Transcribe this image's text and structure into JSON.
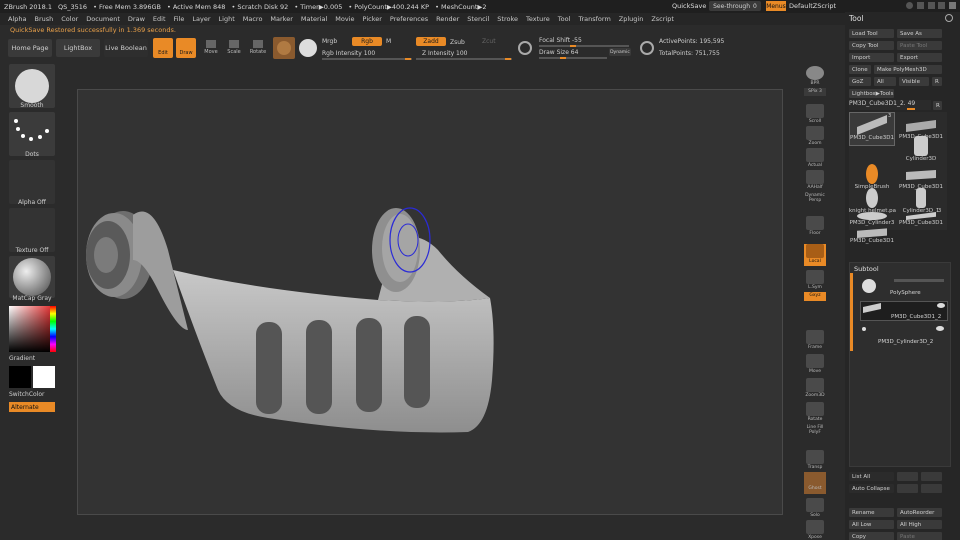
{
  "titlebar": {
    "items": [
      "ZBrush 2018.1",
      "QS_3516",
      "• Free Mem 3.896GB",
      "• Active Mem 848",
      "• Scratch Disk 92",
      "• Timer▶0.005",
      "• PolyCount▶400.244 KP",
      "• MeshCount▶2"
    ],
    "quicksave": "QuickSave",
    "seethrough": "See-through",
    "seethrough_value": "0",
    "menus": "Menus",
    "script": "DefaultZScript"
  },
  "menubar": [
    "Alpha",
    "Brush",
    "Color",
    "Document",
    "Draw",
    "Edit",
    "File",
    "Layer",
    "Light",
    "Macro",
    "Marker",
    "Material",
    "Movie",
    "Picker",
    "Preferences",
    "Render",
    "Stencil",
    "Stroke",
    "Texture",
    "Tool",
    "Transform",
    "Zplugin",
    "Zscript"
  ],
  "status": "QuickSave Restored successfully in 1.369 seconds.",
  "topshelf": {
    "home": "Home Page",
    "lightbox": "LightBox",
    "liveboolean": "Live Boolean",
    "edit": "Edit",
    "draw": "Draw",
    "move": "Move",
    "scale": "Scale",
    "rotate": "Rotate",
    "mrgb": "Mrgb",
    "rgb": "Rgb",
    "m": "M",
    "zadd": "Zadd",
    "zsub": "Zsub",
    "zcut": "Zcut",
    "rgb_intensity": "Rgb Intensity 100",
    "z_intensity": "Z Intensity 100",
    "focal_shift": "Focal Shift -55",
    "draw_size": "Draw Size 64",
    "dynamic": "Dynamic",
    "active_points": "ActivePoints: 195,595",
    "total_points": "TotalPoints: 751,755"
  },
  "leftcol": {
    "brush": "Smooth",
    "stroke": "Dots",
    "alpha": "Alpha Off",
    "texture": "Texture Off",
    "material": "MatCap Gray",
    "gradient": "Gradient",
    "switchcolor": "SwitchColor",
    "alternate": "Alternate"
  },
  "rightshelf": {
    "items": [
      "BPR",
      "SPix 3",
      "Scroll",
      "Zoom",
      "Actual",
      "AAHalf",
      "Dynamic Persp",
      "Floor",
      "Local",
      "L.Sym",
      "Gxyz",
      "Frame",
      "Move",
      "Zoom3D",
      "Rotate",
      "Line Fill PolyF",
      "Transp",
      "Ghost",
      "Solo",
      "Xpose"
    ]
  },
  "tool": {
    "title": "Tool",
    "load": "Load Tool",
    "saveas": "Save As",
    "copy": "Copy Tool",
    "paste": "Paste Tool",
    "import": "Import",
    "export": "Export",
    "clone": "Clone",
    "make_polymesh": "Make PolyMesh3D",
    "goz": "GoZ",
    "all": "All",
    "visible": "Visible",
    "r": "R",
    "lightbox_tools": "Lightbox▶Tools",
    "current": "PM3D_Cube3D1_2. 49",
    "meshes": [
      "PM3D_Cube3D1",
      "PM3D_Cube3D1",
      "Cylinder3D",
      "SimpleBrush",
      "PM3D_Cube3D1",
      "knight helmet.pa",
      "Cylinder3D_1",
      "PM3D_Cylinder3",
      "PM3D_Cube3D1",
      "PM3D_Cube3D1"
    ],
    "badge_a": "3",
    "badge_b": "3",
    "subtool_title": "Subtool",
    "subtools": [
      "PolySphere",
      "PM3D_Cube3D1_2",
      "PM3D_Cylinder3D_2"
    ],
    "listall": "List All",
    "autocollapse": "Auto Collapse",
    "rename": "Rename",
    "autoreorder": "AutoReorder",
    "alllow": "All Low",
    "allhigh": "All High",
    "copy2": "Copy",
    "paste2": "Paste"
  },
  "colors": {
    "accent": "#e98a26",
    "panel": "#262626",
    "canvas": "#333333",
    "model": "#b5b5b5"
  }
}
